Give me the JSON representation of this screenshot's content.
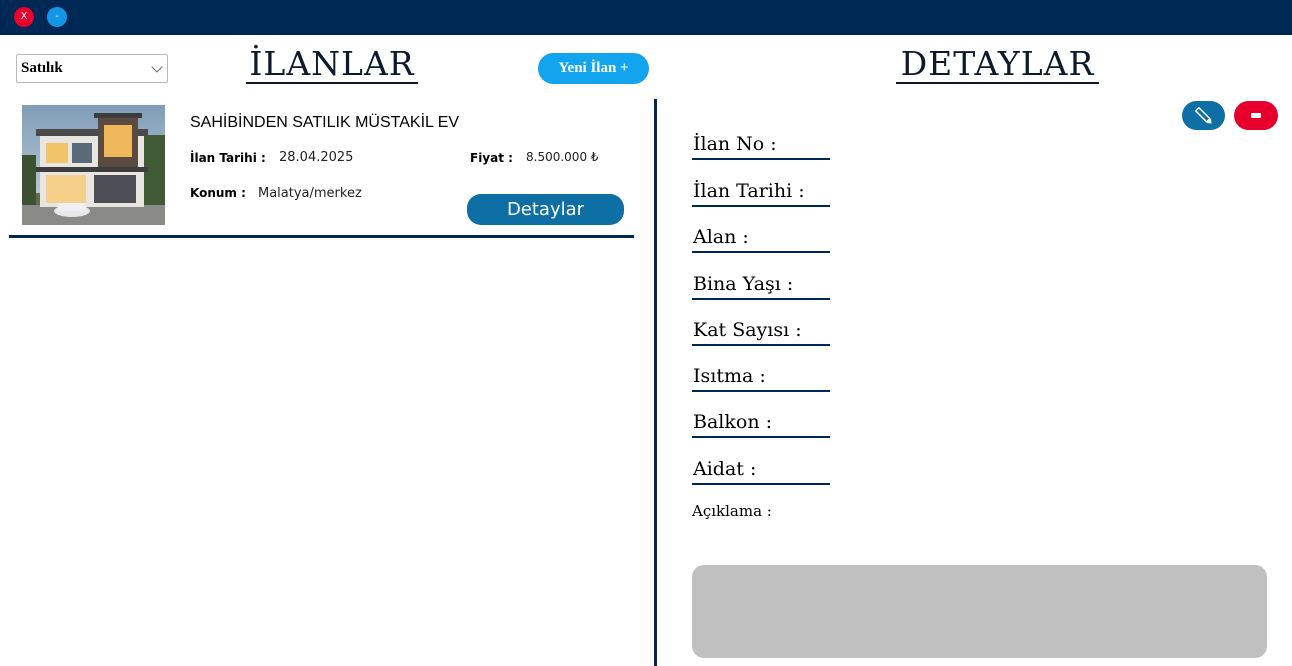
{
  "window": {
    "close_label": "X",
    "minimize_label": "-"
  },
  "filter": {
    "selected": "Satılık"
  },
  "listings_panel": {
    "title": "İLANLAR",
    "new_button": "Yeni İlan +",
    "listings": [
      {
        "title": "SAHİBİNDEN SATILIK MÜSTAKİL EV",
        "date_label": "İlan Tarihi :",
        "date": "28.04.2025",
        "price_label": "Fiyat :",
        "price": "8.500.000 ₺",
        "location_label": "Konum :",
        "location": "Malatya/merkez",
        "details_button": "Detaylar"
      }
    ]
  },
  "details_panel": {
    "title": "DETAYLAR",
    "edit_icon": "pencil-icon",
    "delete_icon": "minus-icon",
    "fields": [
      {
        "label": "İlan No :"
      },
      {
        "label": "İlan Tarihi :"
      },
      {
        "label": "Alan :"
      },
      {
        "label": "Bina Yaşı :"
      },
      {
        "label": "Kat Sayısı :"
      },
      {
        "label": "Isıtma :"
      },
      {
        "label": "Balkon :"
      },
      {
        "label": "Aidat :"
      }
    ],
    "description_label": "Açıklama :",
    "description": ""
  },
  "colors": {
    "navy": "#002855",
    "accent_blue": "#12a4ec",
    "button_blue": "#0d6fa3",
    "danger_red": "#e8002d"
  }
}
